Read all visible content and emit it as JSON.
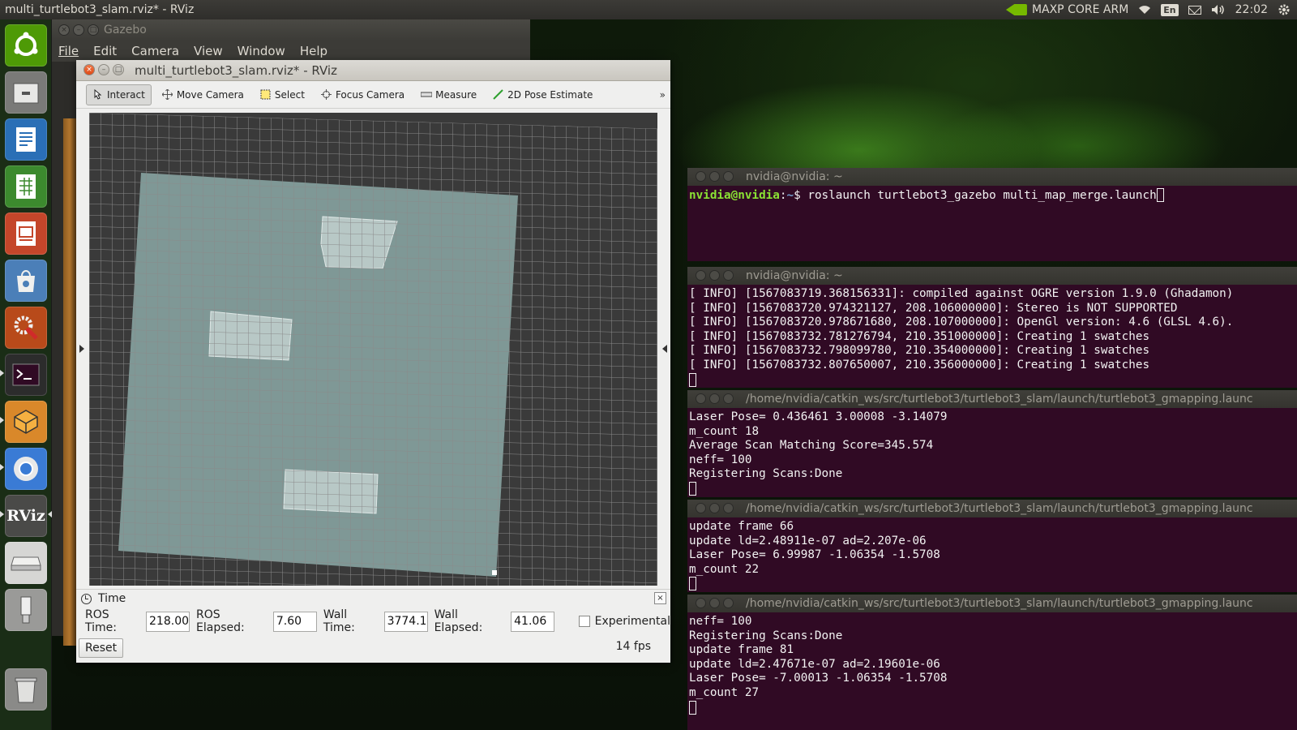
{
  "top_panel": {
    "window_title": "multi_turtlebot3_slam.rviz* - RViz",
    "nvidia_label": "MAXP CORE ARM",
    "keyboard_layout": "En",
    "clock": "22:02"
  },
  "launcher": {
    "items": [
      {
        "name": "ubuntu-dash",
        "color": "#4e9a06"
      },
      {
        "name": "files",
        "color": "#7a7a78"
      },
      {
        "name": "writer",
        "color": "#2a6fb6"
      },
      {
        "name": "calc",
        "color": "#3c8a2e"
      },
      {
        "name": "impress",
        "color": "#c4462a"
      },
      {
        "name": "software-center",
        "color": "#4b7fb8"
      },
      {
        "name": "system-settings",
        "color": "#b84a1a"
      },
      {
        "name": "terminal",
        "color": "#2c2c2c"
      },
      {
        "name": "virtualbox",
        "color": "#d9882a"
      },
      {
        "name": "chromium",
        "color": "#3a7bd5"
      },
      {
        "name": "rviz",
        "color": "#4a4a48",
        "label": "RViz"
      },
      {
        "name": "drive",
        "color": "#d6d6d4"
      },
      {
        "name": "usb",
        "color": "#9a9a98"
      },
      {
        "name": "trash",
        "color": "#8a8a88"
      }
    ]
  },
  "gazebo": {
    "title": "Gazebo",
    "menu": [
      "File",
      "Edit",
      "Camera",
      "View",
      "Window",
      "Help"
    ]
  },
  "rviz": {
    "title": "multi_turtlebot3_slam.rviz* - RViz",
    "tools": [
      {
        "label": "Interact",
        "icon": "cursor-icon",
        "active": true
      },
      {
        "label": "Move Camera",
        "icon": "move-camera-icon",
        "active": false
      },
      {
        "label": "Select",
        "icon": "select-icon",
        "active": false
      },
      {
        "label": "Focus Camera",
        "icon": "focus-camera-icon",
        "active": false
      },
      {
        "label": "Measure",
        "icon": "ruler-icon",
        "active": false
      },
      {
        "label": "2D Pose Estimate",
        "icon": "pose-arrow-icon",
        "active": false
      }
    ],
    "more": "»",
    "time_panel": {
      "title": "Time",
      "ros_time_label": "ROS Time:",
      "ros_time": "218.00",
      "ros_elapsed_label": "ROS Elapsed:",
      "ros_elapsed": "7.60",
      "wall_time_label": "Wall Time:",
      "wall_time": "3774.12",
      "wall_elapsed_label": "Wall Elapsed:",
      "wall_elapsed": "41.06",
      "experimental_label": "Experimental",
      "reset_label": "Reset",
      "fps": "14 fps"
    }
  },
  "terminals": [
    {
      "title": "nvidia@nvidia: ~",
      "prompt_user": "nvidia@nvidia",
      "prompt_sep": ":",
      "prompt_path": "~",
      "prompt_dollar": "$ ",
      "command": "roslaunch turtlebot3_gazebo multi_map_merge.launch"
    },
    {
      "title": "nvidia@nvidia: ~",
      "lines": [
        "[ INFO] [1567083719.368156331]: compiled against OGRE version 1.9.0 (Ghadamon)",
        "[ INFO] [1567083720.974321127, 208.106000000]: Stereo is NOT SUPPORTED",
        "[ INFO] [1567083720.978671680, 208.107000000]: OpenGl version: 4.6 (GLSL 4.6).",
        "[ INFO] [1567083732.781276794, 210.351000000]: Creating 1 swatches",
        "[ INFO] [1567083732.798099780, 210.354000000]: Creating 1 swatches",
        "[ INFO] [1567083732.807650007, 210.356000000]: Creating 1 swatches"
      ]
    },
    {
      "title": "/home/nvidia/catkin_ws/src/turtlebot3/turtlebot3_slam/launch/turtlebot3_gmapping.launc",
      "lines": [
        "Laser Pose= 0.436461 3.00008 -3.14079",
        "m_count 18",
        "Average Scan Matching Score=345.574",
        "neff= 100",
        "Registering Scans:Done"
      ]
    },
    {
      "title": "/home/nvidia/catkin_ws/src/turtlebot3/turtlebot3_slam/launch/turtlebot3_gmapping.launc",
      "lines": [
        "update frame 66",
        "update ld=2.48911e-07 ad=2.207e-06",
        "Laser Pose= 6.99987 -1.06354 -1.5708",
        "m_count 22"
      ]
    },
    {
      "title": "/home/nvidia/catkin_ws/src/turtlebot3/turtlebot3_slam/launch/turtlebot3_gmapping.launc",
      "lines": [
        "neff= 100",
        "Registering Scans:Done",
        "update frame 81",
        "update ld=2.47671e-07 ad=2.19601e-06",
        "Laser Pose= -7.00013 -1.06354 -1.5708",
        "m_count 27"
      ]
    }
  ]
}
